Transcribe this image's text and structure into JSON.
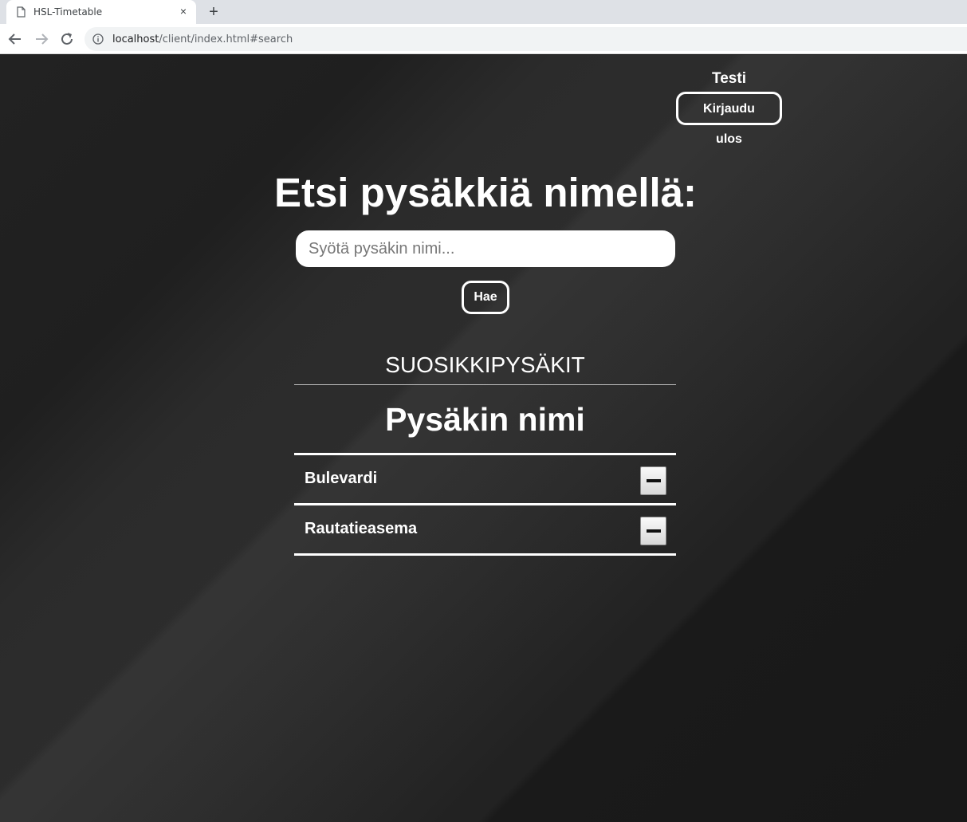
{
  "browser": {
    "tab_title": "HSL-Timetable",
    "tab_close": "×",
    "new_tab": "+",
    "url_host": "localhost",
    "url_path": "/client/index.html#search"
  },
  "user": {
    "name": "Testi",
    "logout_label": "Kirjaudu ulos"
  },
  "search": {
    "title": "Etsi pysäkkiä nimellä:",
    "placeholder": "Syötä pysäkin nimi...",
    "value": "",
    "button_label": "Hae"
  },
  "favorites": {
    "title": "SUOSIKKIPYSÄKIT",
    "column_header": "Pysäkin nimi",
    "stops": [
      {
        "name": "Bulevardi"
      },
      {
        "name": "Rautatieasema"
      }
    ]
  }
}
